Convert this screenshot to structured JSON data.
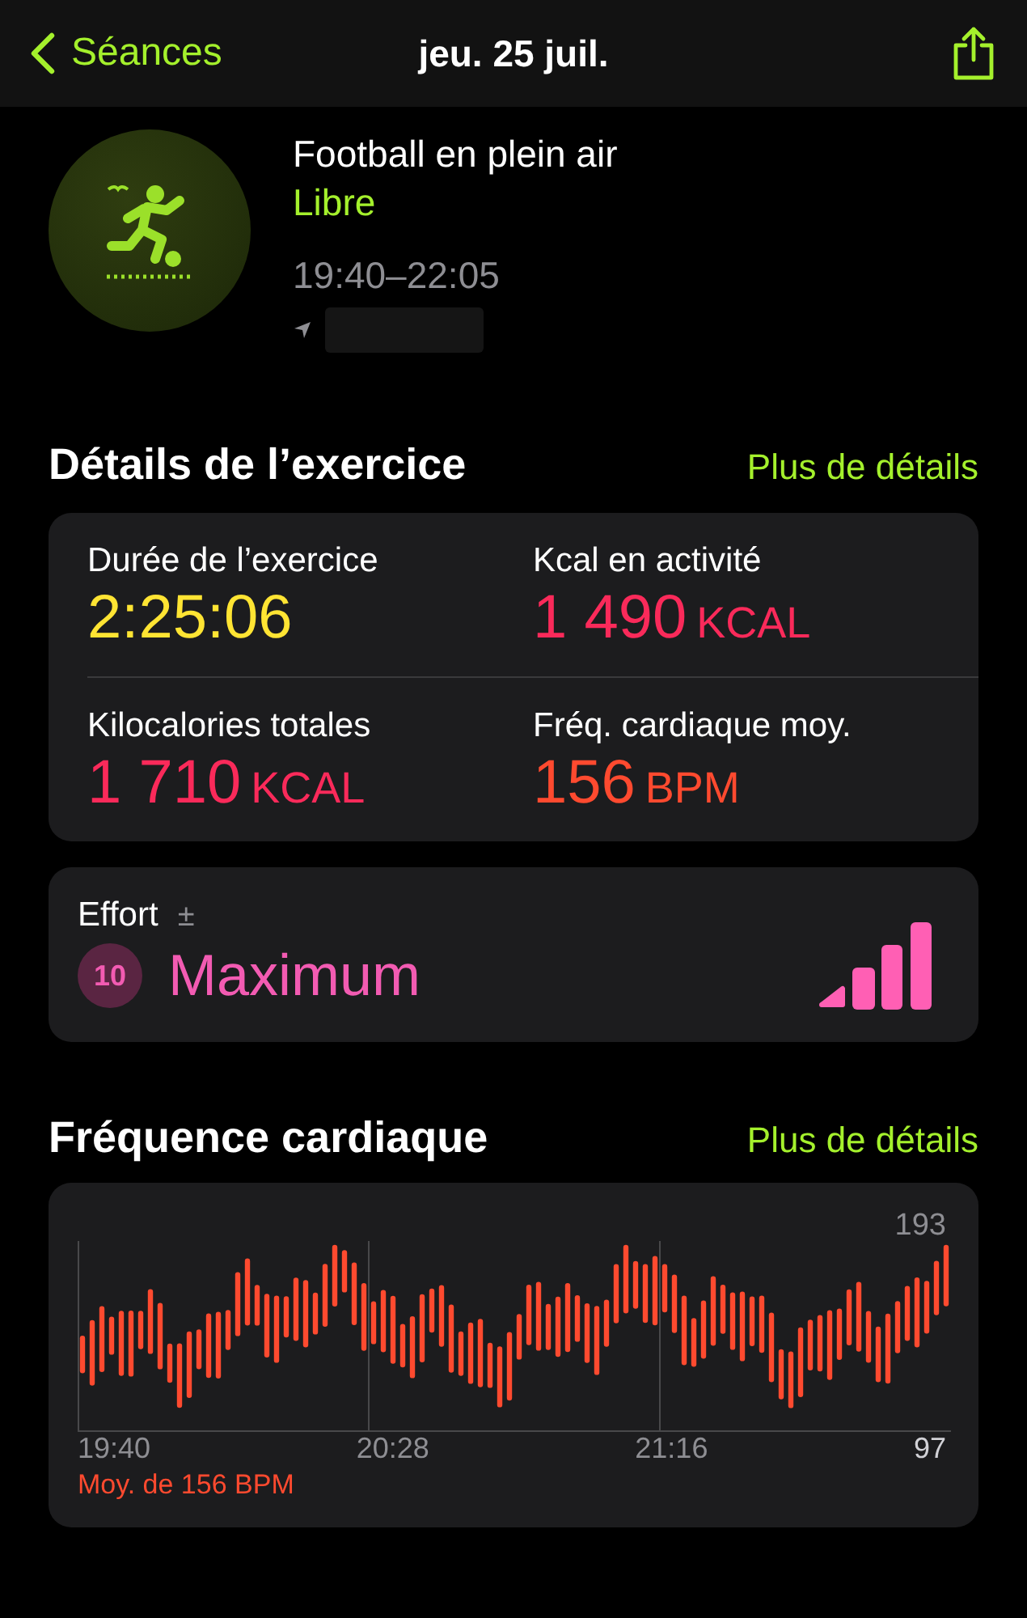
{
  "nav": {
    "back_label": "Séances",
    "title": "jeu. 25 juil."
  },
  "workout": {
    "name": "Football en plein air",
    "type": "Libre",
    "time_range": "19:40–22:05"
  },
  "details": {
    "title": "Détails de l’exercice",
    "link": "Plus de détails",
    "metrics": [
      {
        "label": "Durée de l’exercice",
        "value": "2:25:06",
        "color": "#ffe433"
      },
      {
        "label": "Kcal en activité",
        "value": "1 490",
        "unit": "KCAL",
        "color": "#fa2a5a"
      },
      {
        "label": "Kilocalories totales",
        "value": "1 710",
        "unit": "KCAL",
        "color": "#fa2a5a"
      },
      {
        "label": "Fréq. cardiaque moy.",
        "value": "156",
        "unit": "BPM",
        "color": "#ff4a2f"
      }
    ]
  },
  "effort": {
    "label": "Effort",
    "adjust_symbol": "±",
    "score": "10",
    "rating": "Maximum"
  },
  "heart_rate": {
    "title": "Fréquence cardiaque",
    "link": "Plus de détails",
    "max_label": "193",
    "min_label": "97",
    "x_labels": [
      "19:40",
      "20:28",
      "21:16"
    ],
    "average": "Moy. de 156 BPM"
  }
}
